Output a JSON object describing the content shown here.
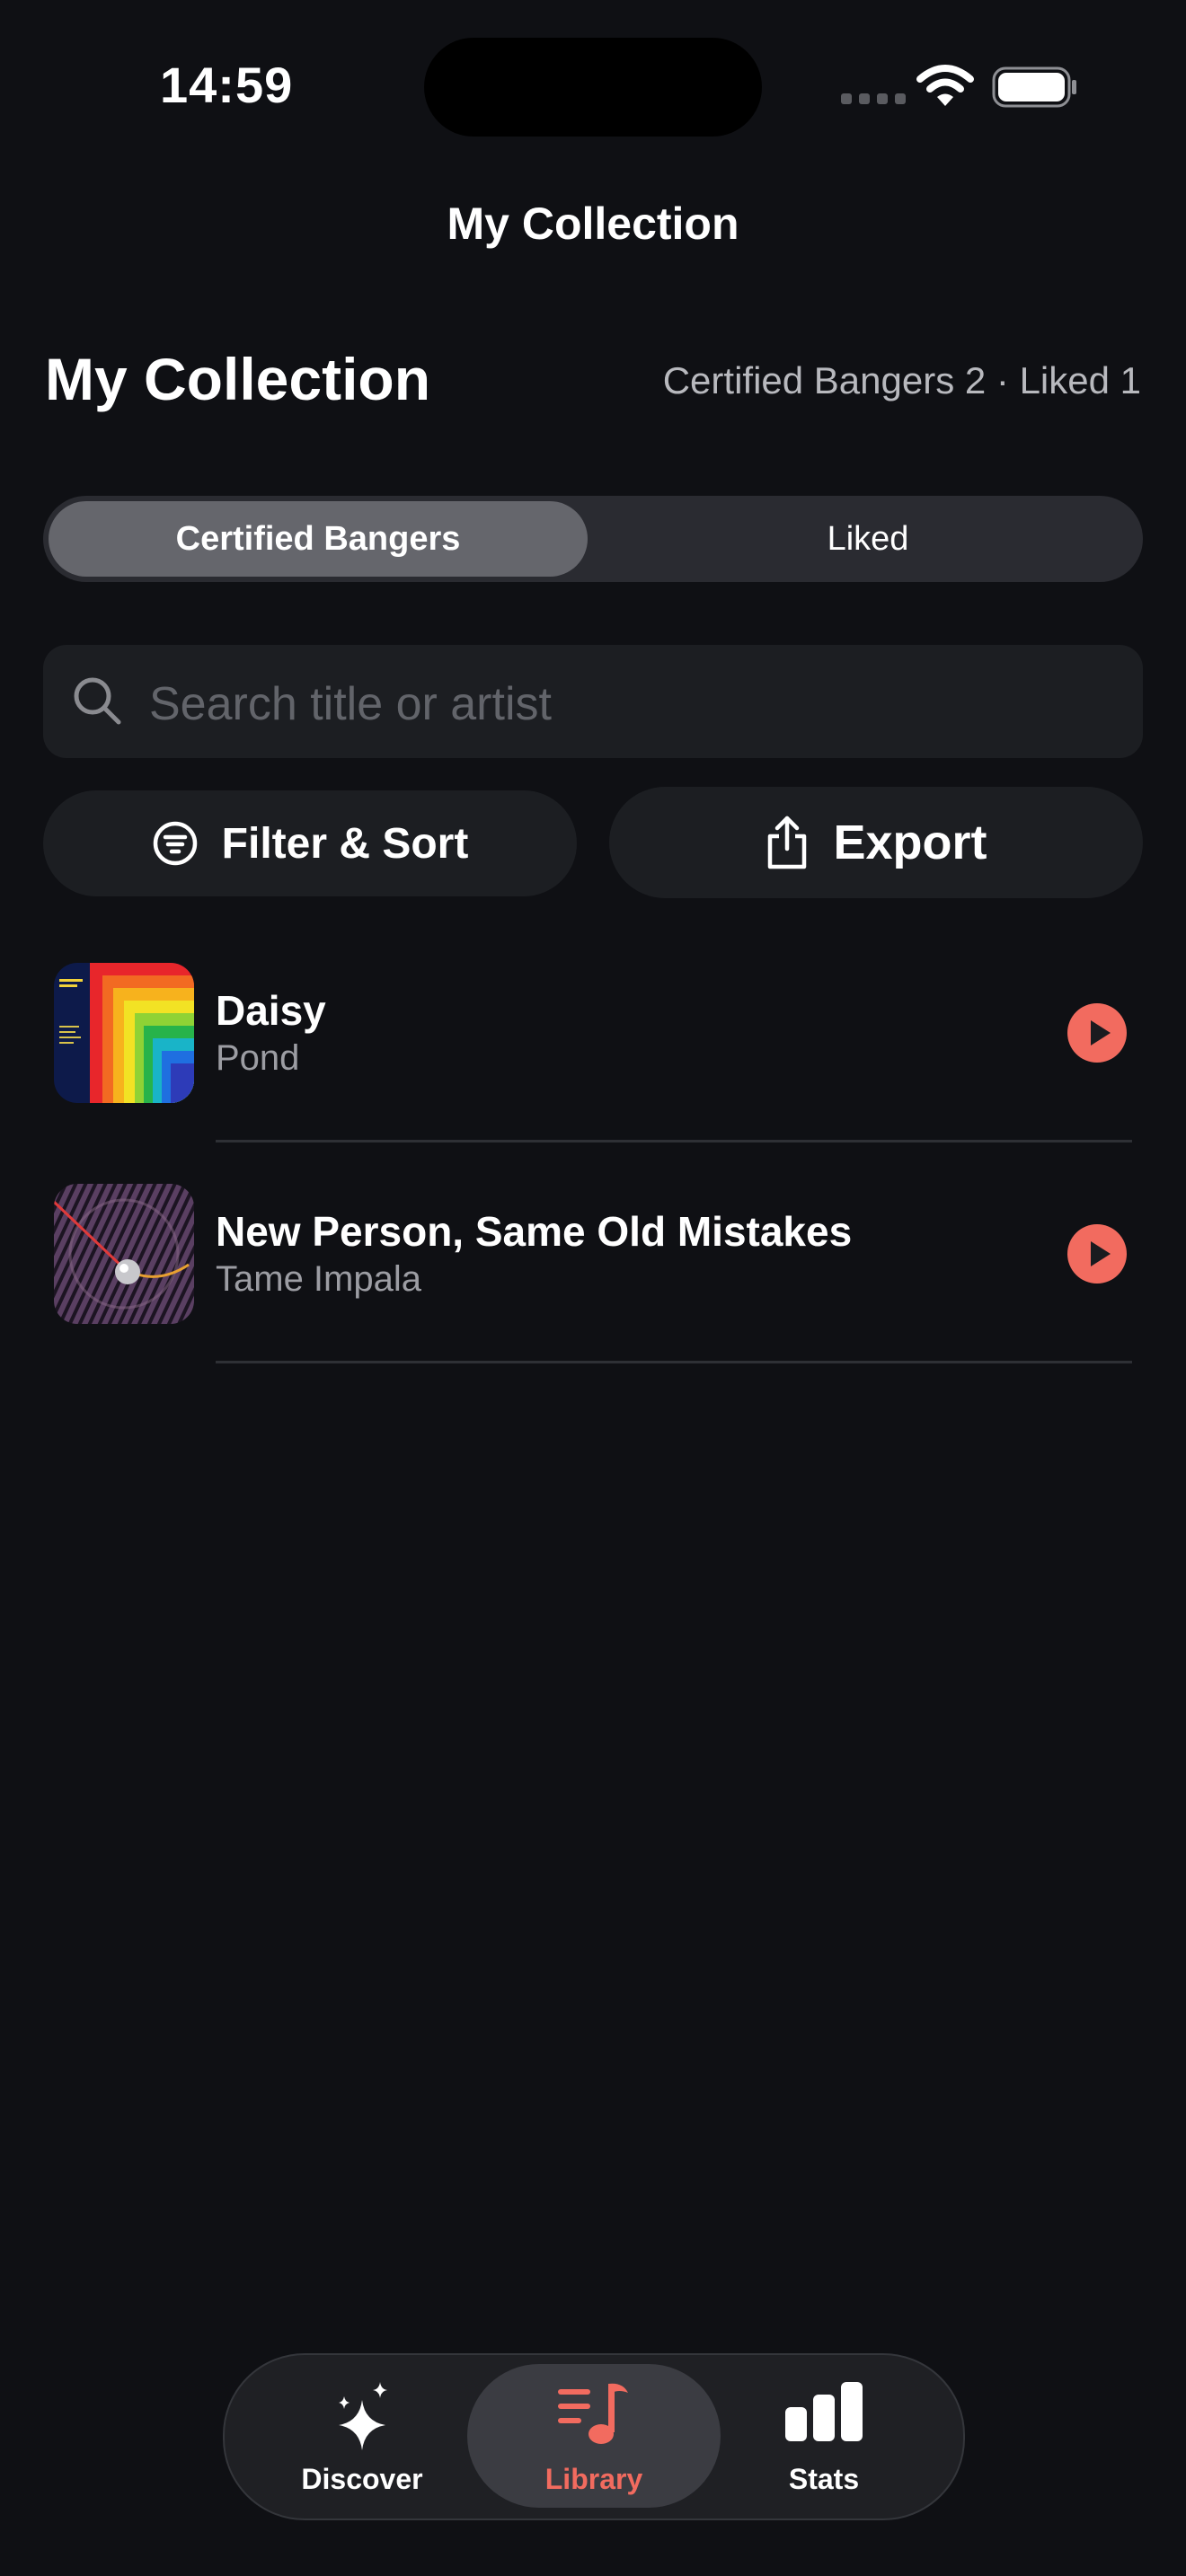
{
  "status_bar": {
    "time": "14:59"
  },
  "nav": {
    "title": "My Collection"
  },
  "header": {
    "title": "My Collection",
    "counts": "Certified Bangers 2 · Liked 1"
  },
  "segmented": {
    "options": [
      "Certified Bangers",
      "Liked"
    ],
    "selected": "Certified Bangers"
  },
  "search": {
    "placeholder": "Search title or artist",
    "value": ""
  },
  "actions": {
    "filter_label": "Filter & Sort",
    "export_label": "Export"
  },
  "tracks": [
    {
      "title": "Daisy",
      "artist": "Pond"
    },
    {
      "title": "New Person, Same Old Mistakes",
      "artist": "Tame Impala"
    }
  ],
  "tabbar": {
    "items": [
      {
        "label": "Discover",
        "icon": "sparkles-icon"
      },
      {
        "label": "Library",
        "icon": "music-library-icon"
      },
      {
        "label": "Stats",
        "icon": "bar-chart-icon"
      }
    ],
    "selected": "Library"
  },
  "colors": {
    "background": "#0f1014",
    "accent": "#f26b5f",
    "surface": "#1c1e22"
  }
}
